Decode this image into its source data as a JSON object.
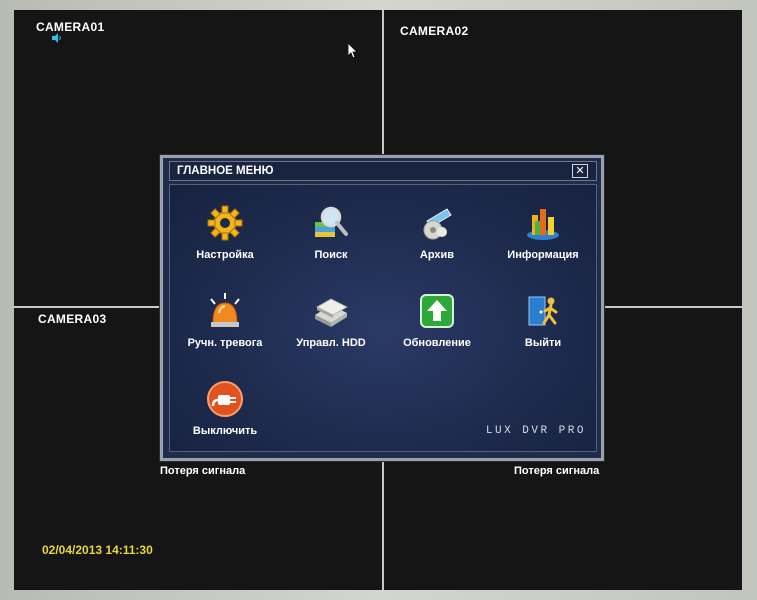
{
  "cameras": {
    "cam1": {
      "label": "CAMERA01"
    },
    "cam2": {
      "label": "CAMERA02"
    },
    "cam3": {
      "label": "CAMERA03"
    },
    "cam4": {
      "label": ""
    }
  },
  "status": {
    "signal_loss_left": "Потеря сигнала",
    "signal_loss_right": "Потеря сигнала",
    "datetime": "02/04/2013 14:11:30"
  },
  "menu": {
    "title": "ГЛАВНОЕ МЕНЮ",
    "close_glyph": "✕",
    "brand": "LUX DVR PRO",
    "items": [
      {
        "label": "Настройка",
        "icon": "gear-icon"
      },
      {
        "label": "Поиск",
        "icon": "search-icon"
      },
      {
        "label": "Архив",
        "icon": "archive-disc-icon"
      },
      {
        "label": "Информация",
        "icon": "chart-icon"
      },
      {
        "label": "Ручн. тревога",
        "icon": "alarm-siren-icon"
      },
      {
        "label": "Управл. HDD",
        "icon": "hdd-icon"
      },
      {
        "label": "Обновление",
        "icon": "upgrade-arrow-icon"
      },
      {
        "label": "Выйти",
        "icon": "exit-door-icon"
      },
      {
        "label": "Выключить",
        "icon": "power-plug-icon"
      }
    ]
  },
  "colors": {
    "menu_background": "#1f2c4c",
    "clock_text": "#e8d63a",
    "grid_lines": "#c8c8c8"
  }
}
